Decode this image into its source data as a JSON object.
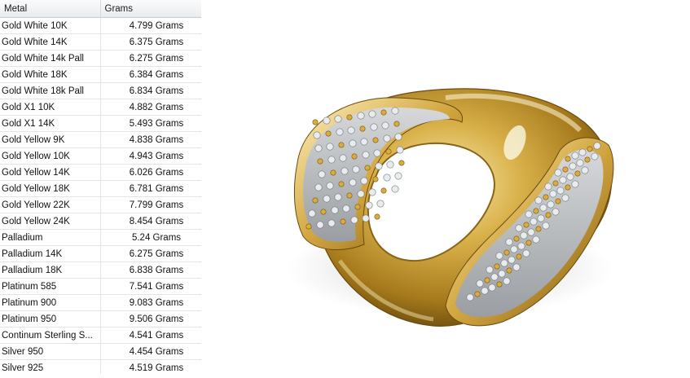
{
  "table": {
    "headers": {
      "metal": "Metal",
      "grams": "Grams"
    },
    "rows": [
      {
        "metal": "Gold White 10K",
        "grams": "4.799 Grams"
      },
      {
        "metal": "Gold White 14K",
        "grams": "6.375 Grams"
      },
      {
        "metal": "Gold White 14k Pall",
        "grams": "6.275 Grams"
      },
      {
        "metal": "Gold White 18K",
        "grams": "6.384 Grams"
      },
      {
        "metal": "Gold White 18k Pall",
        "grams": "6.834 Grams"
      },
      {
        "metal": "Gold X1 10K",
        "grams": "4.882 Grams"
      },
      {
        "metal": "Gold X1 14K",
        "grams": "5.493 Grams"
      },
      {
        "metal": "Gold Yellow 9K",
        "grams": "4.838 Grams"
      },
      {
        "metal": "Gold Yellow 10K",
        "grams": "4.943 Grams"
      },
      {
        "metal": "Gold Yellow 14K",
        "grams": "6.026 Grams"
      },
      {
        "metal": "Gold Yellow 18K",
        "grams": "6.781 Grams"
      },
      {
        "metal": "Gold Yellow 22K",
        "grams": "7.799 Grams"
      },
      {
        "metal": "Gold Yellow 24K",
        "grams": "8.454 Grams"
      },
      {
        "metal": "Palladium",
        "grams": "5.24 Grams"
      },
      {
        "metal": "Palladium 14K",
        "grams": "6.275 Grams"
      },
      {
        "metal": "Palladium 18K",
        "grams": "6.838 Grams"
      },
      {
        "metal": "Platinum 585",
        "grams": "7.541 Grams"
      },
      {
        "metal": "Platinum 900",
        "grams": "9.083 Grams"
      },
      {
        "metal": "Platinum 950",
        "grams": "9.506 Grams"
      },
      {
        "metal": "Continum Sterling S...",
        "grams": "4.541 Grams"
      },
      {
        "metal": "Silver 950",
        "grams": "4.454 Grams"
      },
      {
        "metal": "Silver 925",
        "grams": "4.519 Grams"
      }
    ]
  },
  "render": {
    "subject": "gold-ring-with-pave-diamonds",
    "colors": {
      "gold_light": "#f4e39a",
      "gold_mid": "#c79a2c",
      "gold_dark": "#5e4208",
      "diamond": "#c9cdd0"
    }
  }
}
